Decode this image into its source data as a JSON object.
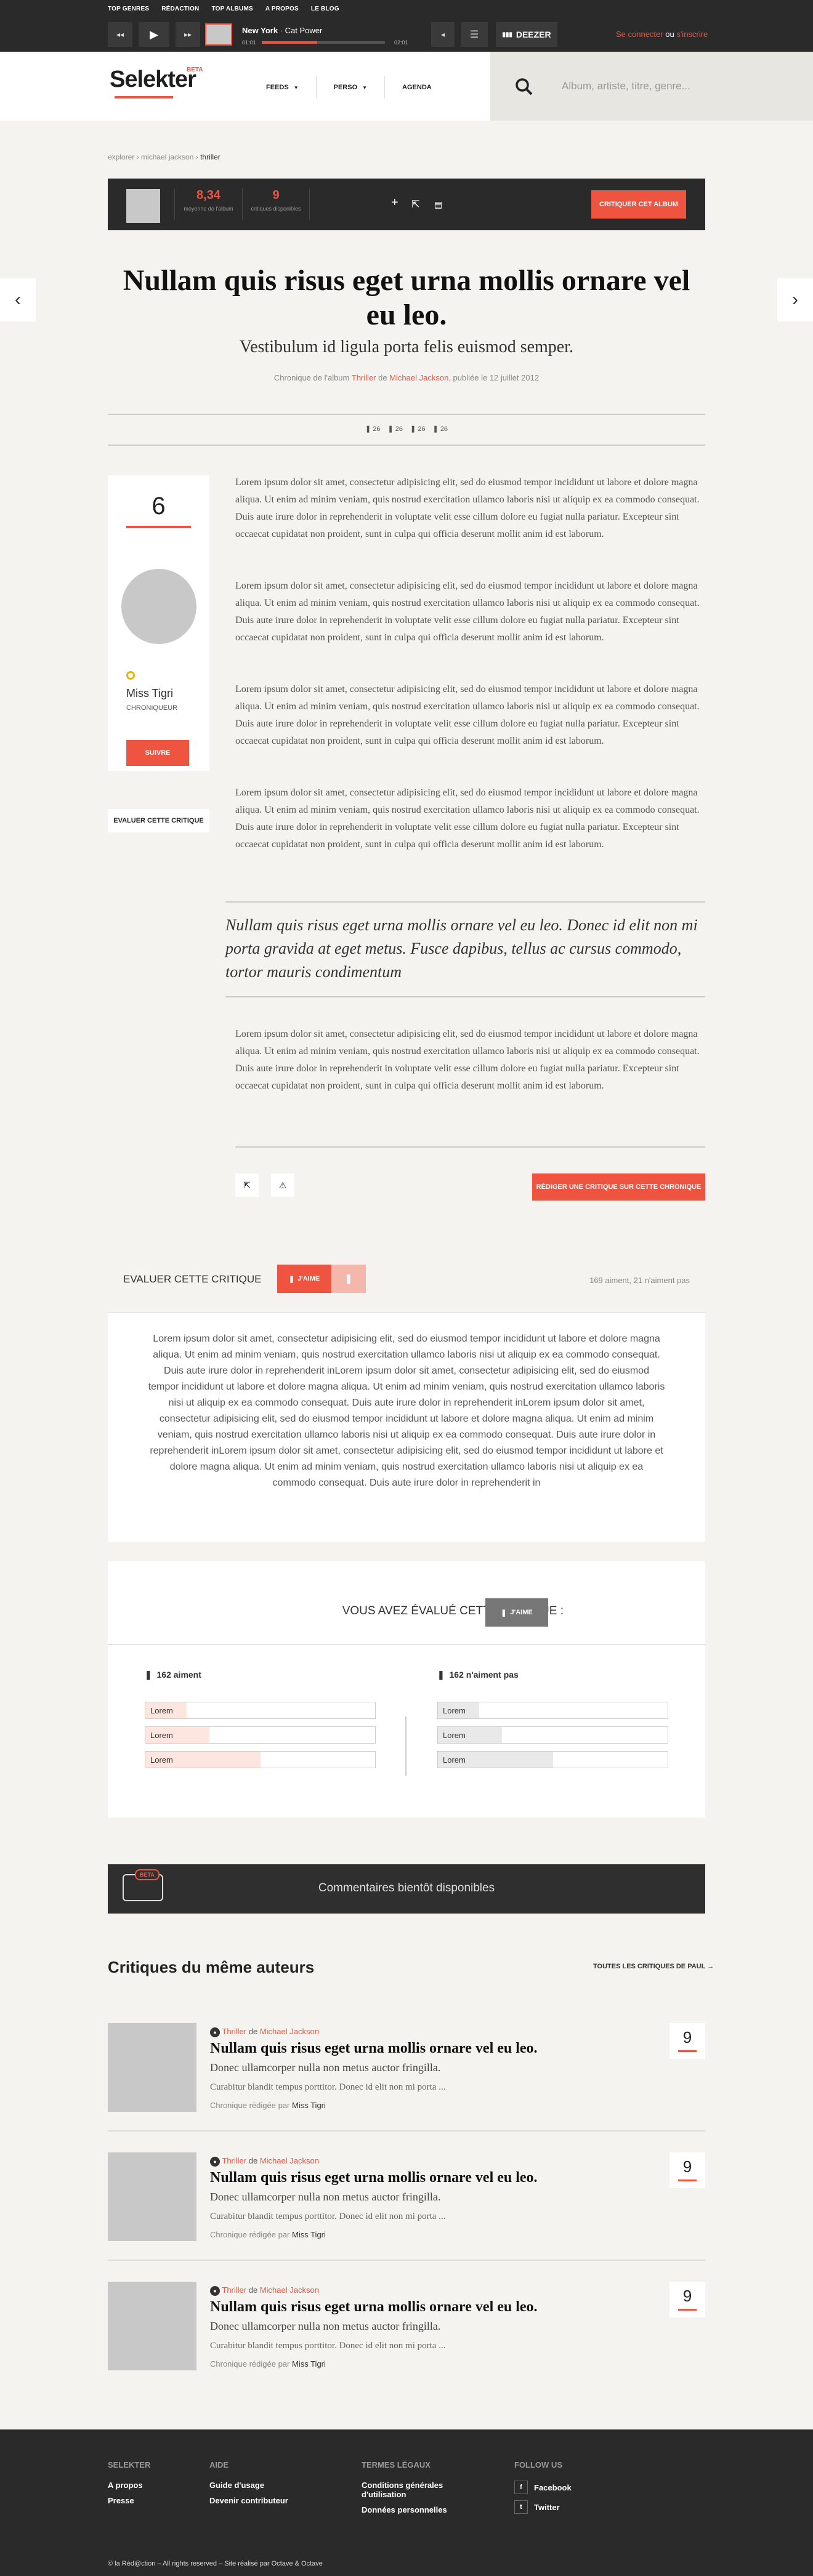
{
  "topnav": [
    "TOP GENRES",
    "RÉDACTION",
    "TOP ALBUMS",
    "A PROPOS",
    "LE BLOG"
  ],
  "player": {
    "artist": "New York",
    "title": "Cat Power",
    "time_elapsed": "01:01",
    "time_total": "02:01",
    "progress": 0.45,
    "deezer_label": "DEEZER"
  },
  "auth": {
    "login": "Se connecter",
    "or": "ou",
    "register": "s'inscrire"
  },
  "logo": {
    "name": "Selekter",
    "beta": "BETA"
  },
  "mainnav": [
    "FEEDS",
    "PERSO",
    "AGENDA"
  ],
  "search": {
    "placeholder": "Album, artiste, titre, genre..."
  },
  "breadcrumb": {
    "root": "explorer",
    "artist": "michael jackson",
    "album": "thriller"
  },
  "albumbar": {
    "avg_value": "8,34",
    "avg_label": "moyenne de l'album",
    "count_value": "9",
    "count_label": "critiques disponibles",
    "critique_button": "CRITIQUER CET ALBUM"
  },
  "article": {
    "title": "Nullam quis risus eget urna mollis ornare vel eu leo.",
    "subtitle": "Vestibulum id ligula porta felis euismod semper.",
    "byline_prefix": "Chronique de l'album",
    "byline_album": "Thriller",
    "byline_de": "de",
    "byline_artist": "Michael Jackson",
    "byline_date": ", publiée le 12 juillet 2012",
    "stats": [
      "26",
      "26",
      "26",
      "26"
    ],
    "paragraph": "Lorem ipsum dolor sit amet, consectetur adipisicing elit, sed do eiusmod tempor incididunt ut labore et dolore magna aliqua. Ut enim ad minim veniam, quis nostrud exercitation ullamco laboris nisi ut aliquip ex ea commodo consequat. Duis aute irure dolor in reprehenderit in voluptate velit esse cillum dolore eu fugiat nulla pariatur. Excepteur sint occaecat cupidatat non proident, sunt in culpa qui officia deserunt mollit anim id est laborum.",
    "quote": "Nullam quis risus eget urna mollis ornare vel eu leo. Donec id elit non mi porta gravida at eget metus. Fusce dapibus, tellus ac cursus commodo, tortor mauris condimentum",
    "write_button": "RÉDIGER UNE CRITIQUE SUR CETTE CHRONIQUE"
  },
  "author": {
    "score": "6",
    "name": "Miss Tigri",
    "role": "CHRONIQUEUR",
    "follow": "SUIVRE",
    "eval_button": "EVALUER CETTE CRITIQUE"
  },
  "evaluate": {
    "label": "EVALUER CETTE CRITIQUE",
    "like": "J'AIME",
    "count": "169 aiment, 21 n'aiment pas",
    "text": "Lorem ipsum dolor sit amet, consectetur adipisicing elit, sed do eiusmod tempor incididunt ut labore et dolore magna aliqua. Ut enim ad minim veniam, quis nostrud exercitation ullamco laboris nisi ut aliquip ex ea commodo consequat. Duis aute irure dolor in reprehenderit inLorem ipsum dolor sit amet, consectetur adipisicing elit, sed do eiusmod tempor incididunt ut labore et dolore magna aliqua. Ut enim ad minim veniam, quis nostrud exercitation ullamco laboris nisi ut aliquip ex ea commodo consequat. Duis aute irure dolor in reprehenderit inLorem ipsum dolor sit amet, consectetur adipisicing elit, sed do eiusmod tempor incididunt ut labore et dolore magna aliqua. Ut enim ad minim veniam, quis nostrud exercitation ullamco laboris nisi ut aliquip ex ea commodo consequat. Duis aute irure dolor in reprehenderit inLorem ipsum dolor sit amet, consectetur adipisicing elit, sed do eiusmod tempor incididunt ut labore et dolore magna aliqua. Ut enim ad minim veniam, quis nostrud exercitation ullamco laboris nisi ut aliquip ex ea commodo consequat. Duis aute irure dolor in reprehenderit in"
  },
  "voted": {
    "label": "VOUS AVEZ ÉVALUÉ CETTE CRITIQUE :",
    "badge": "J'AIME",
    "like_head": "162 aiment",
    "dislike_head": "162 n'aiment pas",
    "like_bars": [
      {
        "label": "Lorem",
        "fill": 0.18
      },
      {
        "label": "Lorem",
        "fill": 0.28
      },
      {
        "label": "Lorem",
        "fill": 0.5
      }
    ],
    "dislike_bars": [
      {
        "label": "Lorem",
        "fill": 0.18
      },
      {
        "label": "Lorem",
        "fill": 0.28
      },
      {
        "label": "Lorem",
        "fill": 0.5
      }
    ]
  },
  "comments": {
    "beta": "BETA",
    "text": "Commentaires bientôt disponibles"
  },
  "same_author": {
    "title": "Critiques du même auteurs",
    "all_link": "TOUTES LES CRITIQUES DE PAUL →",
    "items": [
      {
        "genre": "Thriller",
        "de": "de",
        "artist": "Michael Jackson",
        "title": "Nullam quis risus eget urna mollis ornare vel eu leo.",
        "subtitle": "Donec ullamcorper nulla non metus auctor fringilla.",
        "excerpt": "Curabitur blandit tempus porttitor. Donec id elit non mi porta ...",
        "by": "Chronique rédigée par",
        "author": "Miss Tigri",
        "score": "9"
      },
      {
        "genre": "Thriller",
        "de": "de",
        "artist": "Michael Jackson",
        "title": "Nullam quis risus eget urna mollis ornare vel eu leo.",
        "subtitle": "Donec ullamcorper nulla non metus auctor fringilla.",
        "excerpt": "Curabitur blandit tempus porttitor. Donec id elit non mi porta ...",
        "by": "Chronique rédigée par",
        "author": "Miss Tigri",
        "score": "9"
      },
      {
        "genre": "Thriller",
        "de": "de",
        "artist": "Michael Jackson",
        "title": "Nullam quis risus eget urna mollis ornare vel eu leo.",
        "subtitle": "Donec ullamcorper nulla non metus auctor fringilla.",
        "excerpt": "Curabitur blandit tempus porttitor. Donec id elit non mi porta ...",
        "by": "Chronique rédigée par",
        "author": "Miss Tigri",
        "score": "9"
      }
    ]
  },
  "footer": {
    "cols": [
      {
        "head": "SELEKTER",
        "items": [
          "A propos",
          "Presse"
        ]
      },
      {
        "head": "AIDE",
        "items": [
          "Guide d'usage",
          "Devenir contributeur"
        ]
      },
      {
        "head": "TERMES LÉGAUX",
        "items": [
          "Conditions générales d'utilisation",
          "Données personnelles"
        ]
      },
      {
        "head": "FOLLOW US",
        "items": [
          "Facebook",
          "Twitter"
        ]
      }
    ],
    "copyright": "© la Réd@ction – All rights reserved – Site réalisé par Octave & Octave"
  },
  "colors": {
    "accent": "#ef5440",
    "dark": "#2a2a2a",
    "bg": "#f4f3ef"
  }
}
